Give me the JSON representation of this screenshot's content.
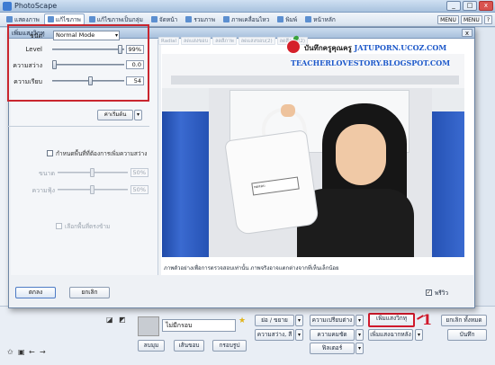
{
  "app": {
    "title": "PhotoScape",
    "tabs": [
      "แสดงภาพ",
      "แก้ไขภาพ",
      "แก้ไขภาพเป็นกลุ่ม",
      "จัดหน้า",
      "รวมภาพ",
      "ภาพเคลื่อนไหว",
      "พิมพ์",
      "หน้าหลัก"
    ],
    "active_tab": "แก้ไขภาพ",
    "right_icons": [
      "MENU",
      "MENU",
      "?"
    ],
    "window_buttons": [
      "_",
      "□",
      "x"
    ]
  },
  "dialog": {
    "title": "เพิ่มแสงวิกทุ",
    "close": "x",
    "settings": {
      "type_label": "ชนิด",
      "type_value": "Normal Mode",
      "level_label": "Level",
      "level_value": "99%",
      "level_fraction": 0.99,
      "brightness_label": "ความสว่าง",
      "brightness_value": "0.0",
      "brightness_fraction": 0.0,
      "smoothness_label": "ความเรียบ",
      "smoothness_value": "54",
      "smoothness_fraction": 0.54
    },
    "adjust_button": "ค่าเริ่มต้น",
    "range": {
      "checkbox_label": "กำหนดพื้นที่ที่ต้องการเพิ่มความสว่าง",
      "size_label": "ขนาด",
      "size_value": "50%",
      "feather_label": "ความฟุ้ง",
      "feather_value": "50%",
      "dim_label": "เลือกพื้นที่ตรงข้าม"
    },
    "effect_tabs": [
      "Radial",
      "ลดแสงขอบ",
      "ลดสีภาพ",
      "ลดแสงขอบ(2)",
      "ลดสีภาพ(2)"
    ],
    "watermark": {
      "line1_thai": "บันทึกครูคุณครู",
      "line1_url": "JATUPORN.UCOZ.COM",
      "line2": "TEACHERLOVESTORY.BLOGSPOT.COM"
    },
    "photo_tag_text": "ทดสอบ",
    "caption": "ภาพตัวอย่างเพื่อการตรวจสอบเท่านั้น ภาพจริงอาจแตกต่างจากที่เห็นเล็กน้อย",
    "preview_label": "พรีวิว",
    "ok_label": "ตกลง",
    "cancel_label": "ยกเลิก"
  },
  "bottom": {
    "frame_select": "ไม่มีกรอบ",
    "frame_btn1": "ลบมุม",
    "frame_btn2": "เส้นขอบ",
    "frame_btn3": "กรอบรูป",
    "tool1": "ย่อ / ขยาย",
    "tool2": "ความสว่าง, สี",
    "tool3": "ความเปรียบต่าง",
    "tool4": "ความคมชัด",
    "tool5": "ฟิลเตอร์",
    "tool6": "เพิ่มแสงวิกทุ",
    "tool7": "เพิ่มแสงฉากหลัง",
    "undo_all": "ยกเลิก ทั้งหมด",
    "save": "บันทึก",
    "marker_number": "1"
  }
}
